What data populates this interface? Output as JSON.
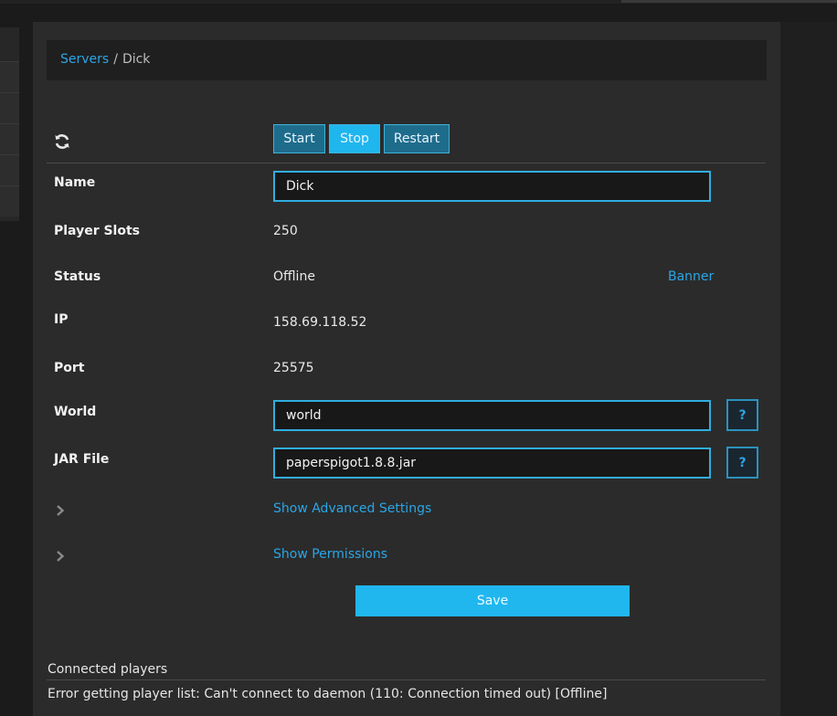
{
  "breadcrumb": {
    "root": "Servers",
    "separator": "/",
    "current": "Dick"
  },
  "controls": {
    "start": "Start",
    "stop": "Stop",
    "restart": "Restart"
  },
  "fields": {
    "name": {
      "label": "Name",
      "value": "Dick"
    },
    "slots": {
      "label": "Player Slots",
      "value": "250"
    },
    "status": {
      "label": "Status",
      "value": "Offline",
      "link": "Banner"
    },
    "ip": {
      "label": "IP",
      "value": "158.69.118.52"
    },
    "port": {
      "label": "Port",
      "value": "25575"
    },
    "world": {
      "label": "World",
      "value": "world",
      "help": "?"
    },
    "jar": {
      "label": "JAR File",
      "value": "paperspigot1.8.8.jar",
      "help": "?"
    }
  },
  "advanced": {
    "show_settings": "Show Advanced Settings",
    "show_permissions": "Show Permissions"
  },
  "save_label": "Save",
  "players": {
    "title": "Connected players",
    "error": "Error getting player list: Can't connect to daemon (110: Connection timed out) [Offline]"
  },
  "icons": {
    "refresh": "refresh-icon",
    "chevron": "chevron-right-icon"
  },
  "colors": {
    "accent": "#1fb6ee",
    "link": "#2ba6e6",
    "panel": "#2b2b2b"
  }
}
